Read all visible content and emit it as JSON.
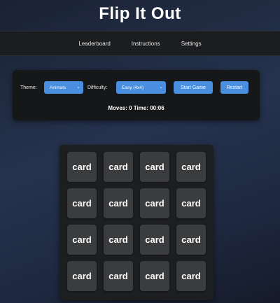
{
  "app": {
    "title": "Flip It Out"
  },
  "nav": {
    "items": [
      "Leaderboard",
      "Instructions",
      "Settings"
    ]
  },
  "controls": {
    "theme_label": "Theme:",
    "theme_value": "Animals",
    "difficulty_label": "Difficulty:",
    "difficulty_value": "Easy (4x4)",
    "start_label": "Start Game",
    "restart_label": "Restart"
  },
  "status": {
    "text": "Moves: 0 Time: 00:06",
    "moves": 0,
    "time": "00:06"
  },
  "board": {
    "rows": 4,
    "cols": 4,
    "card_label": "card",
    "cards": [
      "card",
      "card",
      "card",
      "card",
      "card",
      "card",
      "card",
      "card",
      "card",
      "card",
      "card",
      "card",
      "card",
      "card",
      "card",
      "card"
    ]
  },
  "colors": {
    "accent": "#4a8ee0",
    "panel": "#161718",
    "card": "#3b3c3e"
  }
}
